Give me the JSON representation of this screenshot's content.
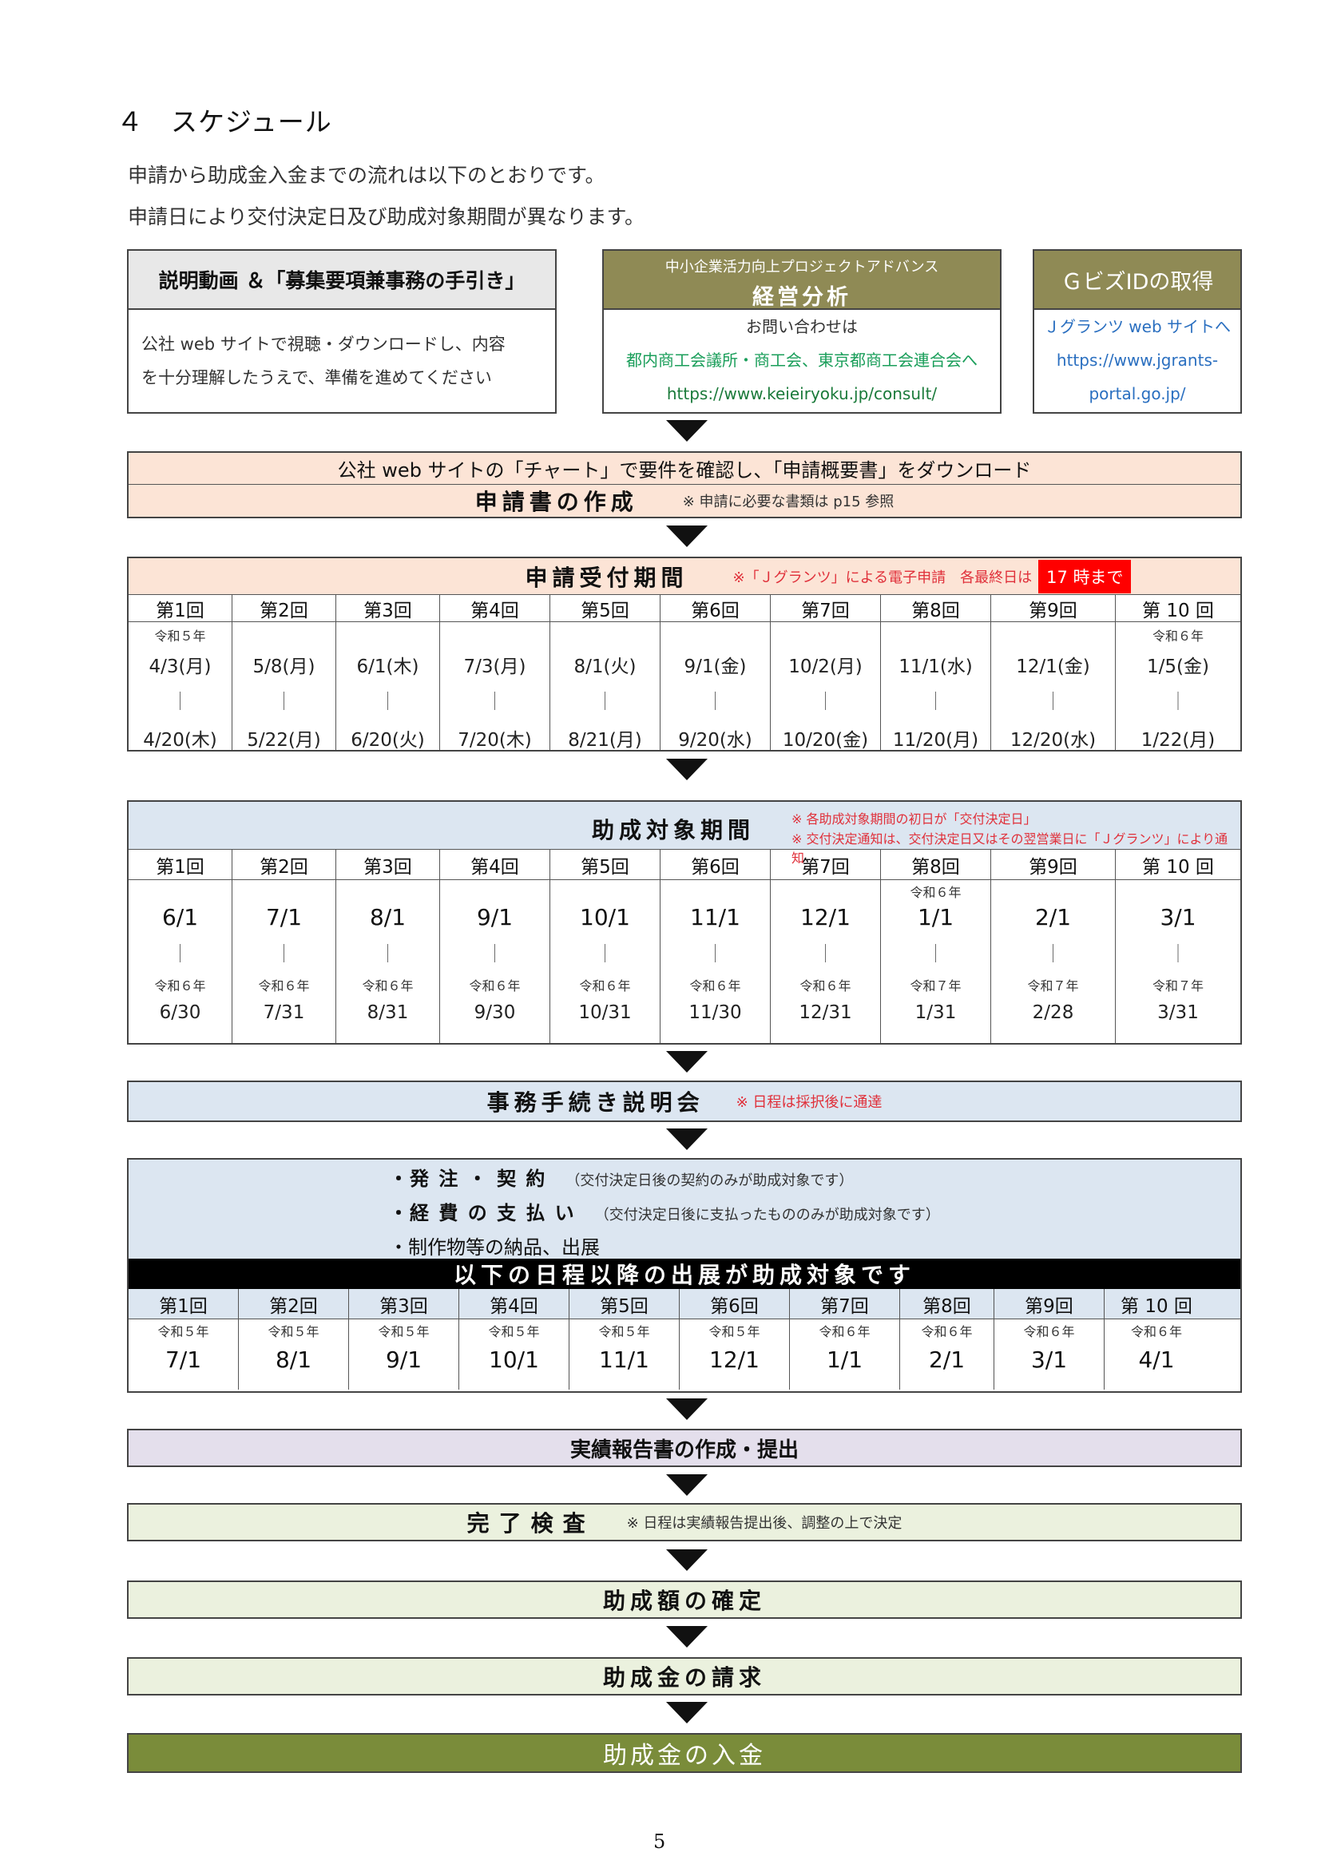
{
  "heading": "４　スケジュール",
  "intro": [
    "申請から助成金入金までの流れは以下のとおりです。",
    "申請日により交付決定日及び助成対象期間が異なります。"
  ],
  "top_boxes": {
    "left": {
      "title": "説明動画 ＆「募集要項兼事務の手引き」",
      "body1": "公社 web サイトで視聴・ダウンロードし、内容",
      "body2": "を十分理解したうえで、準備を進めてください"
    },
    "middle": {
      "subtitle": "中小企業活力向上プロジェクトアドバンス",
      "title": "経営分析",
      "line1": "お問い合わせは",
      "line2": "都内商工会議所・商工会、東京都商工会連合会へ",
      "line3": "https://www.keieiryoku.jp/consult/"
    },
    "right": {
      "title": "ＧビズIDの取得",
      "line1": "Ｊグランツ web サイトへ",
      "line2": "https://www.jgrants-",
      "line3": "portal.go.jp/"
    }
  },
  "step_download": "公社 web サイトの「チャート」で要件を確認し、「申請概要書」をダウンロード",
  "step_create": {
    "title": "申請書の作成",
    "note": "※ 申請に必要な書類は p15 参照"
  },
  "application": {
    "title": "申請受付期間",
    "note": "※「Ｊグランツ」による電子申請　各最終日は",
    "deadline": "17 時まで",
    "rounds": [
      "第1回",
      "第2回",
      "第3回",
      "第4回",
      "第5回",
      "第6回",
      "第7回",
      "第8回",
      "第9回",
      "第 10 回"
    ],
    "era_top": [
      "令和５年",
      "",
      "",
      "",
      "",
      "",
      "",
      "",
      "",
      "令和６年"
    ],
    "start": [
      "4/3(月)",
      "5/8(月)",
      "6/1(木)",
      "7/3(月)",
      "8/1(火)",
      "9/1(金)",
      "10/2(月)",
      "11/1(水)",
      "12/1(金)",
      "1/5(金)"
    ],
    "sep": "｜",
    "end": [
      "4/20(木)",
      "5/22(月)",
      "6/20(火)",
      "7/20(木)",
      "8/21(月)",
      "9/20(水)",
      "10/20(金)",
      "11/20(月)",
      "12/20(水)",
      "1/22(月)"
    ]
  },
  "subsidy_period": {
    "title": "助成対象期間",
    "note1": "※ 各助成対象期間の初日が「交付決定日」",
    "note2": "※ 交付決定通知は、交付決定日又はその翌営業日に「Ｊグランツ」により通知",
    "rounds": [
      "第1回",
      "第2回",
      "第3回",
      "第4回",
      "第5回",
      "第6回",
      "第7回",
      "第8回",
      "第9回",
      "第 10 回"
    ],
    "era_top": [
      "",
      "",
      "",
      "",
      "",
      "",
      "",
      "令和６年",
      "",
      ""
    ],
    "start": [
      "6/1",
      "7/1",
      "8/1",
      "9/1",
      "10/1",
      "11/1",
      "12/1",
      "1/1",
      "2/1",
      "3/1"
    ],
    "sep": "｜",
    "era_end": [
      "令和６年",
      "令和６年",
      "令和６年",
      "令和６年",
      "令和６年",
      "令和６年",
      "令和６年",
      "令和７年",
      "令和７年",
      "令和７年"
    ],
    "end": [
      "6/30",
      "7/31",
      "8/31",
      "9/30",
      "10/31",
      "11/30",
      "12/31",
      "1/31",
      "2/28",
      "3/31"
    ]
  },
  "briefing": {
    "title": "事務手続き説明会",
    "note": "※ 日程は採択後に通達"
  },
  "contract": {
    "line1": "・発 注 ・ 契 約",
    "note1": "（交付決定日後の契約のみが助成対象です）",
    "line2": "・経 費 の 支 払 い",
    "note2": "（交付決定日後に支払ったもののみが助成対象です）",
    "line3": "・制作物等の納品、出展",
    "banner": "以下の日程以降の出展が助成対象です",
    "rounds": [
      "第1回",
      "第2回",
      "第3回",
      "第4回",
      "第5回",
      "第6回",
      "第7回",
      "第8回",
      "第9回",
      "第 10 回"
    ],
    "era": [
      "令和５年",
      "令和５年",
      "令和５年",
      "令和５年",
      "令和５年",
      "令和５年",
      "令和６年",
      "令和６年",
      "令和６年",
      "令和６年"
    ],
    "dates": [
      "7/1",
      "8/1",
      "9/1",
      "10/1",
      "11/1",
      "12/1",
      "1/1",
      "2/1",
      "3/1",
      "4/1"
    ]
  },
  "report": "実績報告書の作成・提出",
  "inspection": {
    "title": "完了検査",
    "note": "※ 日程は実績報告提出後、調整の上で決定"
  },
  "confirm": "助成額の確定",
  "request": "助成金の請求",
  "payment": "助成金の入金",
  "page_number": "5",
  "colors": {
    "peach": "#fce4d6",
    "blue": "#dce6f1",
    "lavender": "#e4dfec",
    "pale_green": "#ebf1de",
    "olive": "#7a8c3a",
    "khaki": "#8f8a55",
    "red": "#ff0000"
  }
}
